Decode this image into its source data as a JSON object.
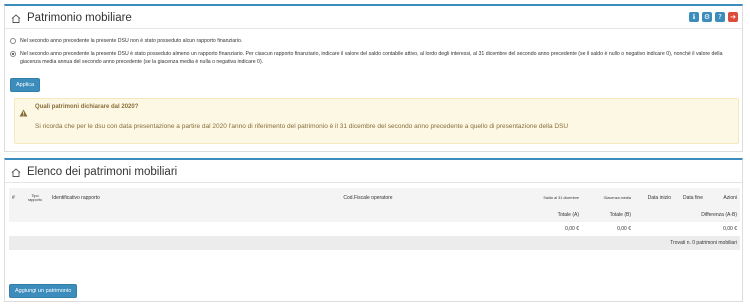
{
  "patrimonio": {
    "title": "Patrimonio mobiliare",
    "toolbar": [
      {
        "name": "info-icon",
        "glyph": "ℹ"
      },
      {
        "name": "settings-icon",
        "glyph": "⚙"
      },
      {
        "name": "help-icon",
        "glyph": "?"
      },
      {
        "name": "exit-icon",
        "glyph": "➔"
      }
    ],
    "option_no": "Nel secondo anno precedente la presente DSU non è stato posseduto alcun rapporto finanziario.",
    "option_yes": "Nel secondo anno precedente la presente DSU è stato posseduto almeno un rapporto finanziario. Per ciascun rapporto finanziario, indicare il valore del saldo contabile attivo, al lordo degli interessi, al 31 dicembre del secondo anno precedente (se il saldo è nullo o negativo indicare 0), nonché il valore della giacenza media annua del secondo anno precedente (se la giacenza media è nulla o negativa indicare 0).",
    "selected_option": "yes",
    "apply_label": "Applica"
  },
  "alert": {
    "title": "Quali patrimoni dichiarare dal 2020?",
    "text": "Si ricorda che per le dsu con data presentazione a partire dal 2020 l'anno di riferimento del patrimonio è il 31 dicembre del secondo anno precedente a quello di presentazione della DSU"
  },
  "elenco": {
    "title": "Elenco dei patrimoni mobiliari",
    "columns": {
      "num": "#",
      "tipo": "Tipo rapporto",
      "identificativo": "Identificativo rapporto",
      "cf": "Cod.Fiscale operatore",
      "saldo": "Saldo al 31 dicembre",
      "giacenza": "Giacenza media",
      "data_inizio": "Data inizio",
      "data_fine": "Data fine",
      "azioni": "Azioni"
    },
    "totals_labels": {
      "a": "Totale (A)",
      "b": "Totale (B)",
      "diff": "Differenza (A-B)"
    },
    "totals_values": {
      "a": "0,00 €",
      "b": "0,00 €",
      "diff": "0,00 €"
    },
    "found_text": "Trovati n. 0 patrimoni mobiliari",
    "add_label": "Aggiungi un patrimonio"
  },
  "colors": {
    "primary": "#3c8dbc",
    "danger": "#dd4b39",
    "warning_bg": "#fcf8e3",
    "warning_text": "#8a6d3b"
  }
}
